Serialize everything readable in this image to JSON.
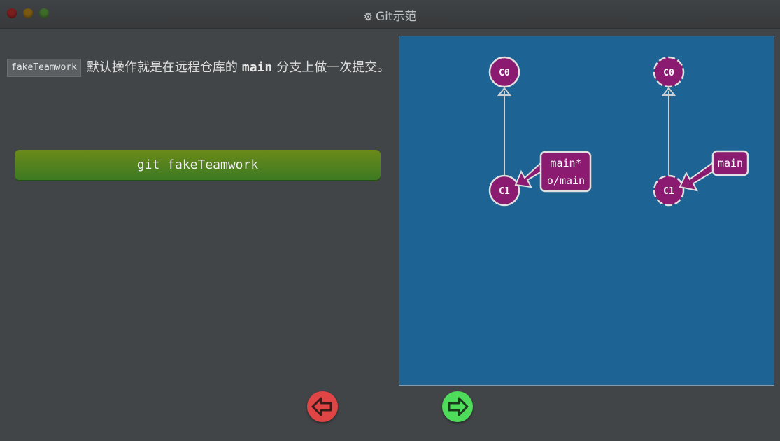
{
  "window": {
    "title": "Git示范",
    "title_icon": "gear-icon"
  },
  "description": {
    "code": "fakeTeamwork",
    "text_before": "默认操作就是在远程仓库的",
    "branch": "main",
    "text_after": "分支上做一次提交。"
  },
  "command_button": {
    "label": "git fakeTeamwork"
  },
  "visualization": {
    "local": {
      "commits": [
        "C0",
        "C1"
      ],
      "branch_label_line1": "main*",
      "branch_label_line2": "o/main"
    },
    "remote": {
      "commits": [
        "C0",
        "C1"
      ],
      "branch_label": "main"
    }
  },
  "navigation": {
    "prev_icon": "arrow-left-icon",
    "next_icon": "arrow-right-icon"
  },
  "colors": {
    "commit_fill": "#8a1b70",
    "canvas_bg": "#1d6495",
    "button_green": "#4e7f1f",
    "prev_red": "#e04545",
    "next_green": "#4fdc5a"
  }
}
